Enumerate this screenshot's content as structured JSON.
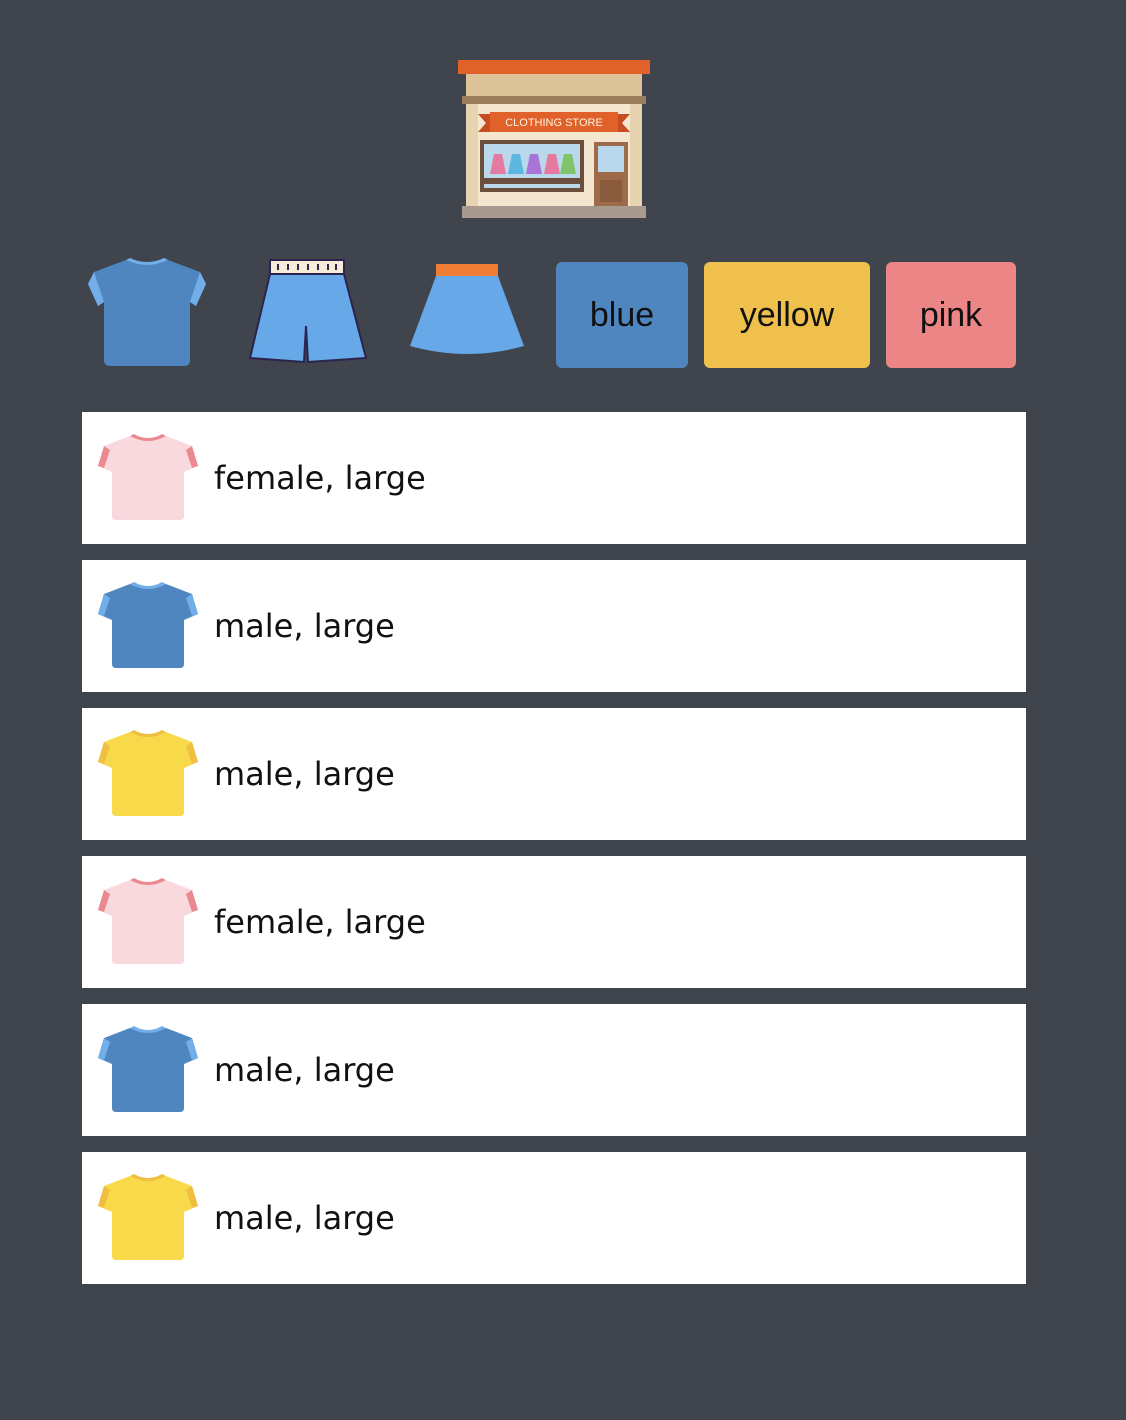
{
  "header": {
    "logo_icon": "clothing-store-icon",
    "logo_text": "CLOTHING STORE"
  },
  "filters": {
    "categories": [
      {
        "icon": "tshirt-icon",
        "color": "#4f86c0"
      },
      {
        "icon": "shorts-icon",
        "color": "#66a8e8"
      },
      {
        "icon": "skirt-icon",
        "color": "#66a8e8"
      }
    ],
    "colors": [
      {
        "label": "blue",
        "color": "#4f86c0"
      },
      {
        "label": "yellow",
        "color": "#f0c04c"
      },
      {
        "label": "pink",
        "color": "#ec8585"
      }
    ]
  },
  "items": [
    {
      "label": "female, large",
      "icon": "tshirt-icon",
      "color": "pink"
    },
    {
      "label": "male, large",
      "icon": "tshirt-icon",
      "color": "blue"
    },
    {
      "label": "male, large",
      "icon": "tshirt-icon",
      "color": "yellow"
    },
    {
      "label": "female, large",
      "icon": "tshirt-icon",
      "color": "pink"
    },
    {
      "label": "male, large",
      "icon": "tshirt-icon",
      "color": "blue"
    },
    {
      "label": "male, large",
      "icon": "tshirt-icon",
      "color": "yellow"
    }
  ],
  "palette": {
    "background": "#40444c",
    "pink": {
      "body": "#fad9de",
      "trim": "#ea8a8f"
    },
    "blue": {
      "body": "#4f86c0",
      "trim": "#71aeea"
    },
    "yellow": {
      "body": "#f7d94a",
      "trim": "#efbf42"
    }
  }
}
